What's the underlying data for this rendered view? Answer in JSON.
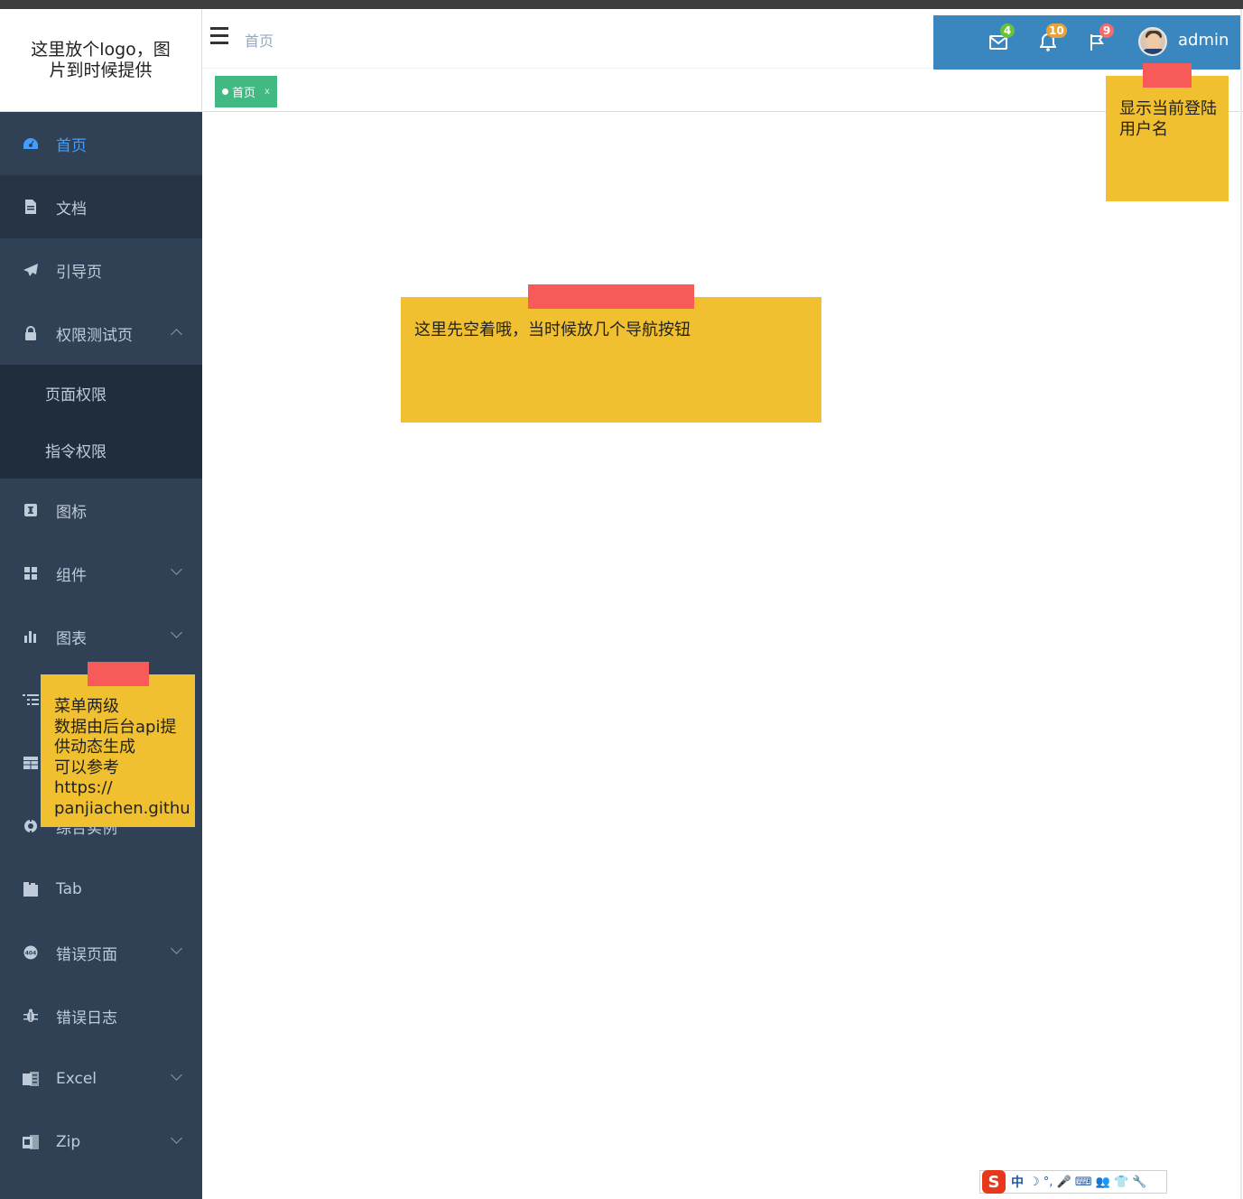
{
  "logo": {
    "text": "这里放个logo，图片到时候提供"
  },
  "breadcrumb": {
    "current": "首页"
  },
  "navbar": {
    "mail_badge": "4",
    "bell_badge": "10",
    "flag_badge": "9",
    "username": "admin",
    "colors": {
      "userbar": "#3a87c0",
      "mail_badge": "#67c23a",
      "bell_badge": "#e6a23c",
      "flag_badge": "#f56c6c"
    }
  },
  "tags": [
    {
      "label": "首页",
      "close": "x",
      "color": "#42b983"
    }
  ],
  "sidebar": {
    "items": [
      {
        "label": "首页",
        "icon": "dashboard-icon",
        "active": true
      },
      {
        "label": "文档",
        "icon": "document-icon"
      },
      {
        "label": "引导页",
        "icon": "paper-plane-icon"
      },
      {
        "label": "权限测试页",
        "icon": "lock-icon",
        "expanded": true,
        "children": [
          {
            "label": "页面权限"
          },
          {
            "label": "指令权限"
          }
        ]
      },
      {
        "label": "图标",
        "icon": "icon-icon"
      },
      {
        "label": "组件",
        "icon": "component-icon",
        "has_children": true
      },
      {
        "label": "图表",
        "icon": "chart-icon",
        "has_children": true
      },
      {
        "label": "",
        "icon": "tree-icon"
      },
      {
        "label": "",
        "icon": "table-icon"
      },
      {
        "label": "综合实例",
        "icon": "example-icon"
      },
      {
        "label": "Tab",
        "icon": "tab-icon"
      },
      {
        "label": "错误页面",
        "icon": "404-icon",
        "has_children": true
      },
      {
        "label": "错误日志",
        "icon": "bug-icon"
      },
      {
        "label": "Excel",
        "icon": "excel-icon",
        "has_children": true
      },
      {
        "label": "Zip",
        "icon": "zip-icon",
        "has_children": true
      }
    ]
  },
  "notes": {
    "username": {
      "text": "显示当前登陆用户名"
    },
    "nav": {
      "text": "这里先空着哦，当时候放几个导航按钮"
    },
    "menu": {
      "line1": "菜单两级",
      "line2": "数据由后台api提",
      "line3": "供动态生成",
      "line4": "可以参考",
      "line5": "https://",
      "line6": "panjiachen.githu"
    }
  },
  "ime": {
    "mode": "中",
    "symbols": "☽ °, 🎤 ⌨ 👥 👕 🔧"
  }
}
